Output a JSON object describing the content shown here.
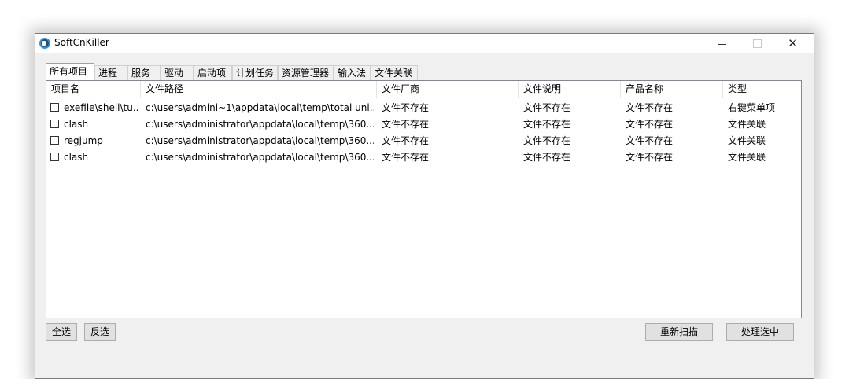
{
  "window": {
    "title": "SoftCnKiller"
  },
  "tabs": [
    {
      "label": "所有项目",
      "active": true
    },
    {
      "label": "进程"
    },
    {
      "label": "服务"
    },
    {
      "label": "驱动"
    },
    {
      "label": "启动项"
    },
    {
      "label": "计划任务"
    },
    {
      "label": "资源管理器"
    },
    {
      "label": "输入法"
    },
    {
      "label": "文件关联"
    }
  ],
  "list": {
    "columns": [
      "项目名",
      "文件路径",
      "文件厂商",
      "文件说明",
      "产品名称",
      "类型"
    ],
    "rows": [
      {
        "name": "exefile\\shell\\tu...",
        "path": "c:\\users\\admini~1\\appdata\\local\\temp\\total uni...",
        "vendor": "文件不存在",
        "desc": "文件不存在",
        "product": "文件不存在",
        "type": "右键菜单项",
        "checked": false
      },
      {
        "name": "clash",
        "path": "c:\\users\\administrator\\appdata\\local\\temp\\360...",
        "vendor": "文件不存在",
        "desc": "文件不存在",
        "product": "文件不存在",
        "type": "文件关联",
        "checked": false
      },
      {
        "name": "regjump",
        "path": "c:\\users\\administrator\\appdata\\local\\temp\\360...",
        "vendor": "文件不存在",
        "desc": "文件不存在",
        "product": "文件不存在",
        "type": "文件关联",
        "checked": false
      },
      {
        "name": "clash",
        "path": "c:\\users\\administrator\\appdata\\local\\temp\\360...",
        "vendor": "文件不存在",
        "desc": "文件不存在",
        "product": "文件不存在",
        "type": "文件关联",
        "checked": false
      }
    ]
  },
  "buttons": {
    "select_all": "全选",
    "invert": "反选",
    "rescan": "重新扫描",
    "process": "处理选中"
  }
}
